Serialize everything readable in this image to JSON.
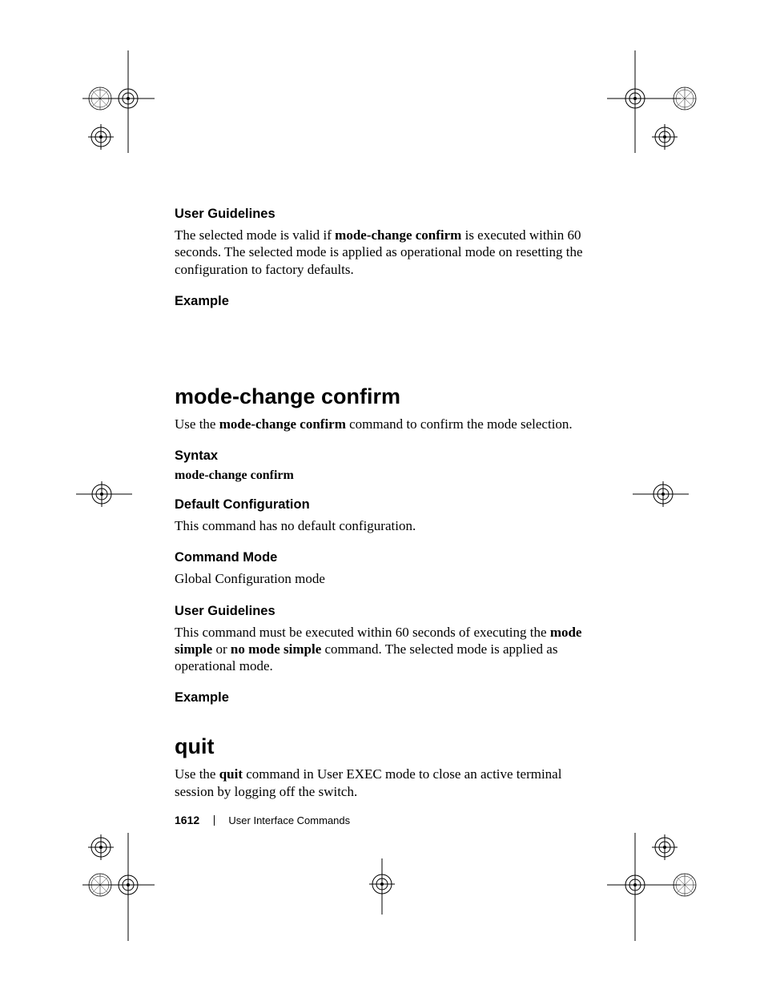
{
  "section1": {
    "h_user_guidelines": "User Guidelines",
    "user_guidelines_pre": "The selected mode is valid if ",
    "user_guidelines_bold": "mode-change confirm",
    "user_guidelines_post": " is executed within 60 seconds. The selected mode is applied as operational mode on resetting the configuration to factory defaults.",
    "h_example": "Example"
  },
  "section2": {
    "title": "mode-change confirm",
    "intro_pre": "Use the ",
    "intro_bold": "mode-change confirm",
    "intro_post": " command to confirm the mode selection.",
    "h_syntax": "Syntax",
    "syntax_line": "mode-change confirm",
    "h_default": "Default Configuration",
    "default_body": "This command has no default configuration.",
    "h_mode": "Command Mode",
    "mode_body": "Global Configuration mode",
    "h_user_guidelines": "User Guidelines",
    "ug_pre": "This command must be executed within 60 seconds of executing the ",
    "ug_b1": "mode simple",
    "ug_mid": " or ",
    "ug_b2": "no mode simple",
    "ug_post": " command. The selected mode is applied as operational mode.",
    "h_example": "Example"
  },
  "section3": {
    "title": "quit",
    "intro_pre": "Use the ",
    "intro_bold": "quit",
    "intro_post": " command in User EXEC mode to close an active terminal session by logging off the switch."
  },
  "footer": {
    "page_number": "1612",
    "chapter": "User Interface Commands"
  }
}
